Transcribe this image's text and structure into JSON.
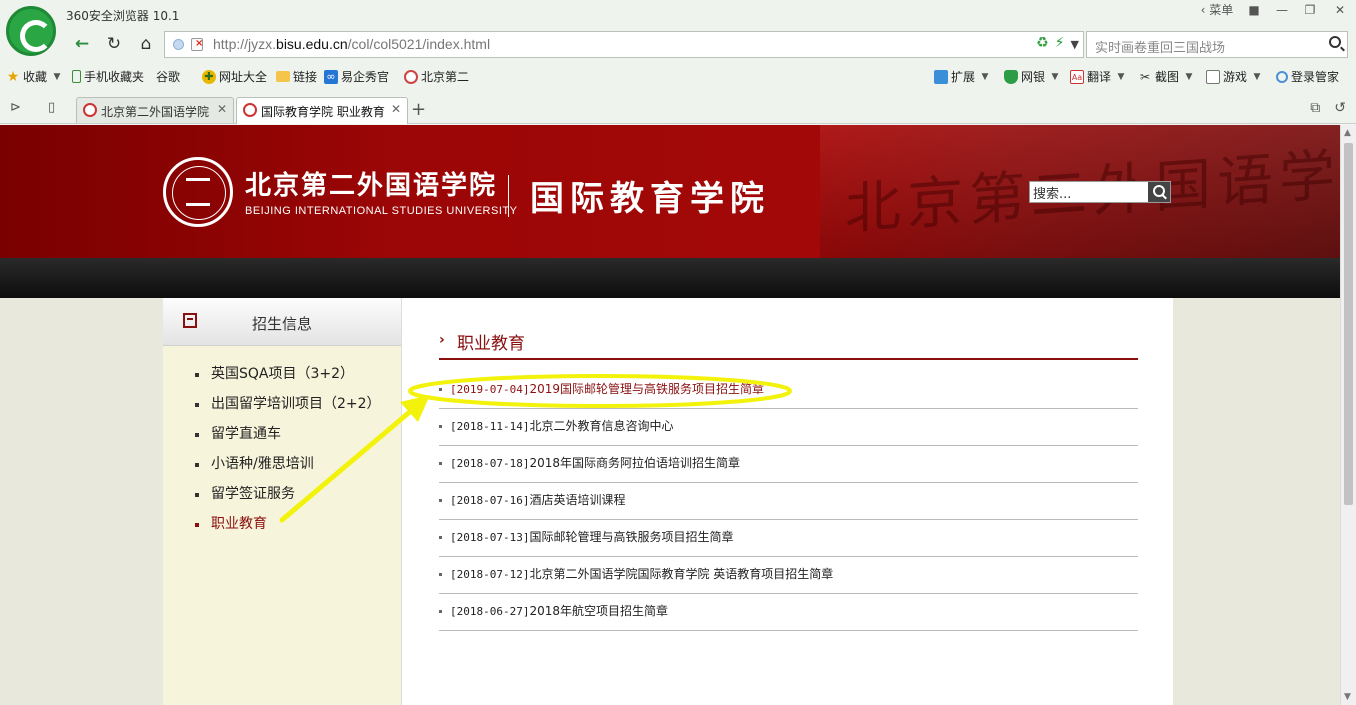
{
  "browser": {
    "title": "360安全浏览器 10.1",
    "menu_label": "菜单",
    "url_prefix": "http://jyzx.",
    "url_domain": "bisu.edu.cn",
    "url_path": "/col/col5021/index.html",
    "search_placeholder": "实时画卷重回三国战场",
    "bookmarks": {
      "collect": "收藏",
      "mobile": "手机收藏夹",
      "google": "谷歌",
      "sites": "网址大全",
      "links": "链接",
      "yiqi": "易企秀官",
      "bjer": "北京第二"
    },
    "tools": {
      "extend": "扩展",
      "bank": "网银",
      "translate": "翻译",
      "screenshot": "截图",
      "games": "游戏",
      "login": "登录管家"
    },
    "tabs": [
      {
        "label": "北京第二外国语学院"
      },
      {
        "label": "国际教育学院 职业教育"
      }
    ],
    "accent_color": "#2aa744"
  },
  "site": {
    "university_cn": "北京第二外国语学院",
    "university_en": "BEIJING INTERNATIONAL STUDIES UNIVERSITY",
    "school_name": "国际教育学院",
    "banner_wall_text": "北京第二外国语学院",
    "search_value": "搜索...",
    "brand_color": "#8a0f0f"
  },
  "sidebar": {
    "title": "招生信息",
    "items": [
      {
        "label": "英国SQA项目（3+2）"
      },
      {
        "label": "出国留学培训项目（2+2）"
      },
      {
        "label": "留学直通车"
      },
      {
        "label": "小语种/雅思培训"
      },
      {
        "label": "留学签证服务"
      },
      {
        "label": "职业教育"
      }
    ]
  },
  "main": {
    "title": "职业教育",
    "news": [
      {
        "date": "[2019-07-04]",
        "title": "2019国际邮轮管理与高铁服务项目招生简章"
      },
      {
        "date": "[2018-11-14]",
        "title": "北京二外教育信息咨询中心"
      },
      {
        "date": "[2018-07-18]",
        "title": "2018年国际商务阿拉伯语培训招生简章"
      },
      {
        "date": "[2018-07-16]",
        "title": "酒店英语培训课程"
      },
      {
        "date": "[2018-07-13]",
        "title": "国际邮轮管理与高铁服务项目招生简章"
      },
      {
        "date": "[2018-07-12]",
        "title": "北京第二外国语学院国际教育学院 英语教育项目招生简章"
      },
      {
        "date": "[2018-06-27]",
        "title": "2018年航空项目招生简章"
      }
    ]
  },
  "annotation": {
    "highlight_color": "#f2f20a"
  }
}
